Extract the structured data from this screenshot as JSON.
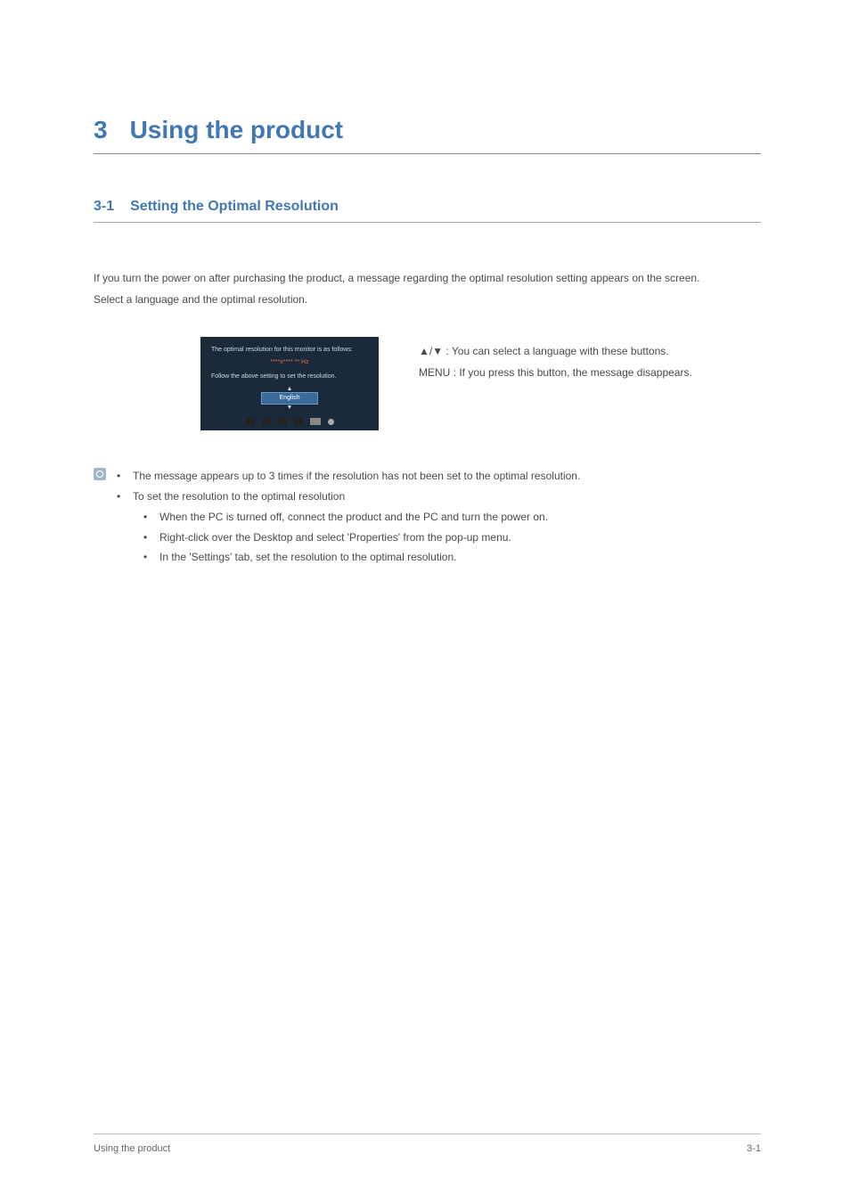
{
  "chapter": {
    "number": "3",
    "title": "Using the product"
  },
  "section": {
    "number": "3-1",
    "title": "Setting the Optimal Resolution"
  },
  "intro": {
    "line1": "If you turn the power on after purchasing the product, a message regarding the optimal resolution setting appears on the screen.",
    "line2": "Select a language and the optimal resolution."
  },
  "osd": {
    "line1": "The optimal resolution for this monitor is as follows:",
    "res": "****x**** ** Hz",
    "line2": "Follow the above setting to set the resolution.",
    "lang": "English"
  },
  "desc": {
    "arrows": "▲/▼ : You can select a language with these buttons.",
    "menu": "MENU : If you press this button, the message disappears."
  },
  "notes": {
    "item1": "The message appears up to 3 times if the resolution has not been set to the optimal resolution.",
    "item2": "To set the resolution to the optimal resolution",
    "sub1": "When the PC is turned off, connect the product and the PC and turn the power on.",
    "sub2": "Right-click over the Desktop and select 'Properties' from the pop-up menu.",
    "sub3": "In the 'Settings' tab, set the resolution to the optimal resolution."
  },
  "footer": {
    "left": "Using the product",
    "right": "3-1"
  }
}
